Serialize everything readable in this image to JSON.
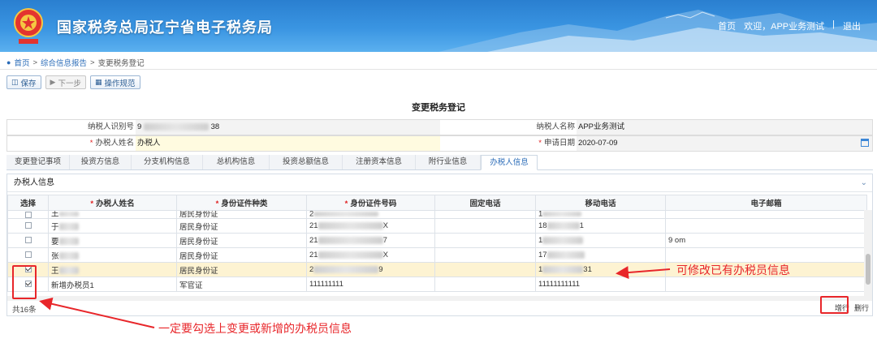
{
  "header": {
    "title": "国家税务总局辽宁省电子税务局",
    "links": [
      "首页",
      "欢迎，APP业务测试",
      "|",
      "退出"
    ]
  },
  "breadcrumb": [
    "首页",
    ">",
    "综合信息报告",
    ">",
    "变更税务登记"
  ],
  "toolbar": {
    "save": "保存",
    "next": "下一步",
    "guide": "操作规范"
  },
  "form": {
    "title": "变更税务登记",
    "taxpayer_id_label": "纳税人识别号",
    "taxpayer_id_prefix": "9",
    "taxpayer_id_suffix": "38",
    "taxpayer_name_label": "纳税人名称",
    "taxpayer_name": "APP业务测试",
    "agent_name_label": "办税人姓名",
    "agent_name": "办税人",
    "apply_date_label": "申请日期",
    "apply_date": "2020-07-09"
  },
  "tabs": [
    "变更登记事项",
    "投资方信息",
    "分支机构信息",
    "总机构信息",
    "投资总额信息",
    "注册资本信息",
    "附行业信息",
    "办税人信息"
  ],
  "panel": {
    "title": "办税人信息",
    "columns": [
      "选择",
      "办税人姓名",
      "身份证件种类",
      "身份证件号码",
      "固定电话",
      "移动电话",
      "电子邮箱"
    ],
    "rows": [
      {
        "checked": false,
        "name": "王",
        "id_type": "居民身份证",
        "id_no_pre": "2",
        "id_no_suf": "",
        "mobile_pre": "1",
        "mobile_suf": "",
        "email": ""
      },
      {
        "checked": false,
        "name": "于",
        "id_type": "居民身份证",
        "id_no_pre": "21",
        "id_no_suf": "X",
        "mobile_pre": "18",
        "mobile_suf": "1",
        "email": ""
      },
      {
        "checked": false,
        "name": "要",
        "id_type": "居民身份证",
        "id_no_pre": "21",
        "id_no_suf": "7",
        "mobile_pre": "1",
        "mobile_suf": "",
        "email": "9 om"
      },
      {
        "checked": false,
        "name": "张",
        "id_type": "居民身份证",
        "id_no_pre": "21",
        "id_no_suf": "X",
        "mobile_pre": "17",
        "mobile_suf": "",
        "email": ""
      },
      {
        "checked": true,
        "name": "王",
        "id_type": "居民身份证",
        "id_no_pre": "2",
        "id_no_suf": "9",
        "mobile_pre": "1",
        "mobile_suf": "31",
        "email": ""
      },
      {
        "checked": true,
        "name": "新增办税员1",
        "id_type": "军官证",
        "id_no_pre": "111111111",
        "id_no_suf": "",
        "mobile_pre": "11111111111",
        "mobile_suf": "",
        "email": ""
      }
    ],
    "total": "共16条",
    "add_row": "增行",
    "del_row": "删行"
  },
  "annotations": {
    "modify_note": "可修改已有办税员信息",
    "check_note": "一定要勾选上变更或新增的办税员信息"
  },
  "colors": {
    "accent": "#2b6cb8",
    "annotation": "#e8262a",
    "header": "#2a7fd0"
  }
}
